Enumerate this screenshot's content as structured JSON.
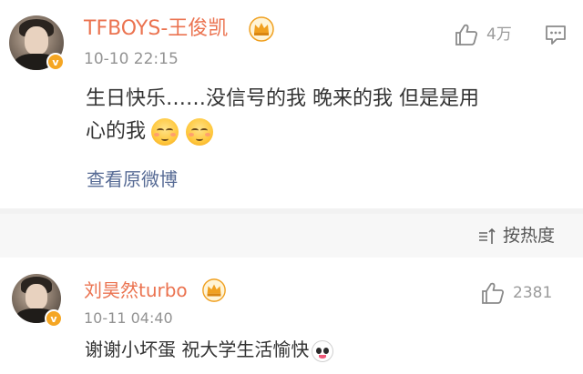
{
  "post": {
    "author": "TFBOYS-王俊凯",
    "time": "10-10 22:15",
    "like_count": "4万",
    "text_line1": "生日快乐……没信号的我 晚来的我 但是是用",
    "text_line2": "心的我",
    "emojis": [
      "smiling-face-emoji",
      "smiling-face-emoji"
    ],
    "view_original": "查看原微博"
  },
  "sort": {
    "label": "按热度"
  },
  "comment": {
    "author": "刘昊然turbo",
    "time": "10-11 04:40",
    "like_count": "2381",
    "text": "谢谢小坏蛋 祝大学生活愉快",
    "emoji": "panda-face-emoji"
  },
  "badge": {
    "letter": "v"
  },
  "colors": {
    "name": "#eb7350",
    "link": "#576b95",
    "badge": "#f5a623",
    "crown": "#f0a020"
  }
}
